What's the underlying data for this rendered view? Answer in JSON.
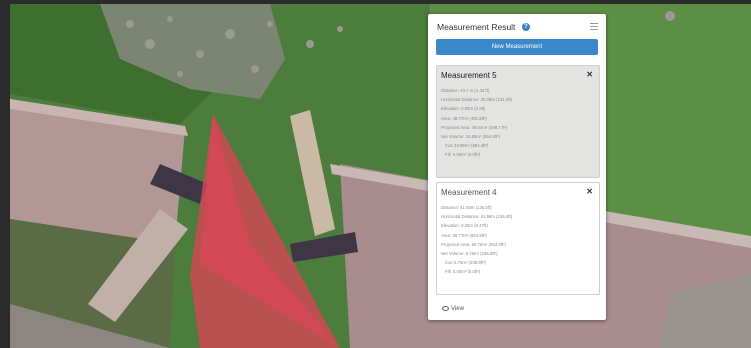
{
  "panel": {
    "title": "Measurement Result",
    "help_icon": "question-circle-icon",
    "menu_icon": "hamburger-menu-icon",
    "new_button": "New Measurement",
    "view_link": "View"
  },
  "measurements": [
    {
      "title": "Measurement 5",
      "close_icon": "close-icon",
      "lines": [
        "Distance: 43.7 m (1.43 ft)",
        "Horizontal Distance: 40.09m (131.5ft)",
        "Elevation: 0.90m (2.9ft)",
        "Area: 48.77m² (491.9ft²)",
        "Projected Area: 49.64m² (488.7 ft²)",
        "Net Volume: 24.89m³ (854.5ft³)",
        "Cut: 24.89m³ (854.4ft³)",
        "Fill: 0.00m³ (0.0ft³)"
      ]
    },
    {
      "title": "Measurement 4",
      "close_icon": "close-icon",
      "lines": [
        "Distance: 41.60m (136.5ft)",
        "Horizontal Distance: 41.58m (136.4ft)",
        "Elevation: 0.25m (0.47ft)",
        "Area: 60.77m² (653.9ft²)",
        "Projected Area: 60.76m² (653.9ft²)",
        "Net Volume: 6.76m³ (238.8ft³)",
        "Cut: 6.76m³ (238.8ft³)",
        "Fill: 0.00m³ (0.0ft³)"
      ]
    }
  ]
}
